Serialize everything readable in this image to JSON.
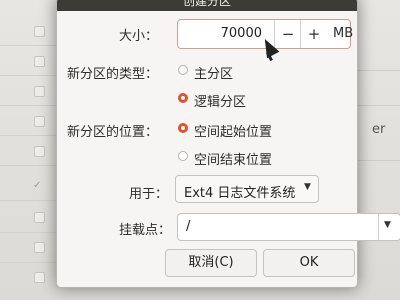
{
  "dialog": {
    "title": "创建分区",
    "size_label": "大小：",
    "size_value": "70000",
    "minus_label": "−",
    "plus_label": "+",
    "size_unit": "MB",
    "type_label": "新分区的类型：",
    "type_options": [
      {
        "label": "主分区",
        "selected": false
      },
      {
        "label": "逻辑分区",
        "selected": true
      }
    ],
    "location_label": "新分区的位置：",
    "location_options": [
      {
        "label": "空间起始位置",
        "selected": true
      },
      {
        "label": "空间结束位置",
        "selected": false
      }
    ],
    "use_as_label": "用于：",
    "use_as_value": "Ext4 日志文件系统",
    "mount_label": "挂载点：",
    "mount_value": "/",
    "cancel_label": "取消(C)",
    "ok_label": "OK"
  },
  "background": {
    "edge_text": "er",
    "accent_color": "#e1542a"
  }
}
